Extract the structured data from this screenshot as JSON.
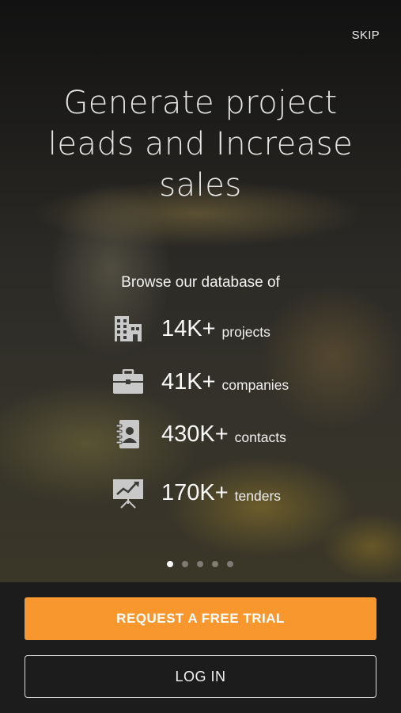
{
  "header": {
    "skip_label": "SKIP"
  },
  "hero": {
    "headline_lines": [
      "Generate project",
      "leads and Increase",
      "sales"
    ],
    "browse_text": "Browse our database of"
  },
  "stats": [
    {
      "value": "14K+",
      "label": "projects",
      "icon": "building-icon"
    },
    {
      "value": "41K+",
      "label": "companies",
      "icon": "briefcase-icon"
    },
    {
      "value": "430K+",
      "label": "contacts",
      "icon": "contact-book-icon"
    },
    {
      "value": "170K+",
      "label": "tenders",
      "icon": "presentation-chart-icon"
    }
  ],
  "pagination": {
    "total": 5,
    "active_index": 0
  },
  "actions": {
    "trial_label": "REQUEST A FREE TRIAL",
    "login_label": "LOG IN"
  },
  "colors": {
    "accent": "#f7972d",
    "bottom_bar": "#1c1c1c"
  }
}
